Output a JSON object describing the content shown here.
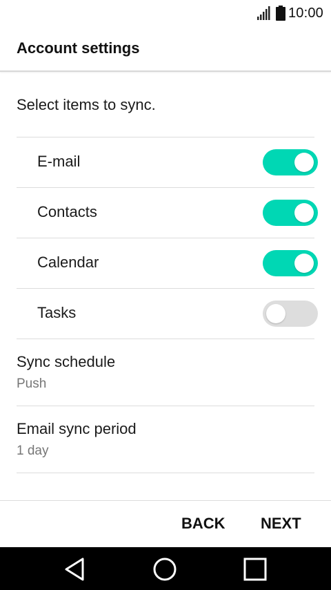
{
  "status_bar": {
    "time": "10:00",
    "icons": [
      "signal-icon",
      "battery-icon"
    ]
  },
  "app_bar": {
    "title": "Account settings"
  },
  "sync_section": {
    "label": "Select items to sync.",
    "items": [
      {
        "label": "E-mail",
        "enabled": true
      },
      {
        "label": "Contacts",
        "enabled": true
      },
      {
        "label": "Calendar",
        "enabled": true
      },
      {
        "label": "Tasks",
        "enabled": false
      }
    ]
  },
  "settings": {
    "sync_schedule": {
      "title": "Sync schedule",
      "value": "Push"
    },
    "email_sync_period": {
      "title": "Email sync period",
      "value": "1 day"
    }
  },
  "actions": {
    "back_label": "BACK",
    "next_label": "NEXT"
  },
  "nav_bar": {
    "icons": [
      "back-triangle-icon",
      "home-circle-icon",
      "recent-apps-square-icon"
    ]
  },
  "colors": {
    "toggle_on": "#00d7b4",
    "toggle_off": "#dddddd",
    "secondary_text": "#767676",
    "nav_bar_bg": "#000000"
  }
}
